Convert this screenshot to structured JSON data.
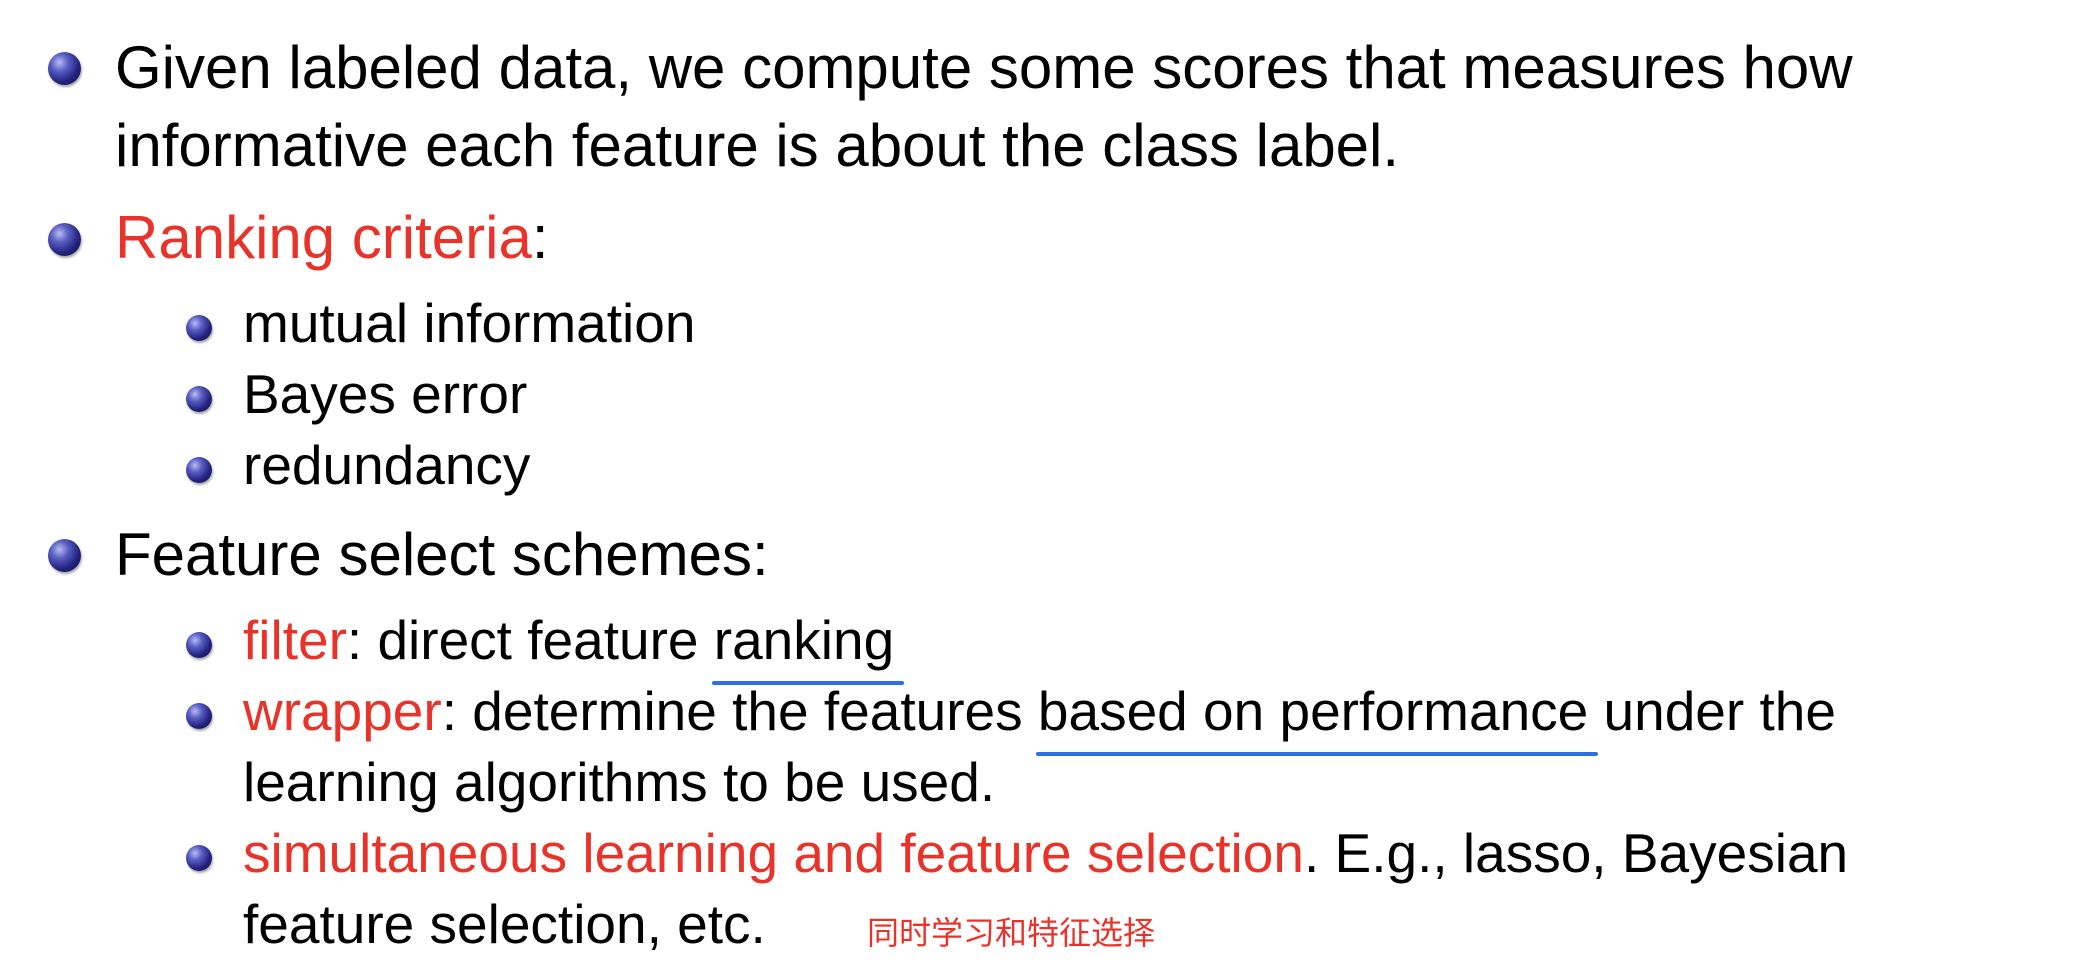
{
  "bullets": {
    "b1_line1": "Given labeled data, we compute some scores that measures how",
    "b1_line2": "informative each feature is about the class label.",
    "b2_red": "Ranking criteria",
    "b2_colon": ":",
    "criteria": [
      "mutual information",
      "Bayes error",
      "redundancy"
    ],
    "b3": "Feature select schemes:",
    "filter_label": "filter",
    "filter_text_a": ": direct feature ",
    "filter_text_u": "ranking",
    "wrapper_label": "wrapper",
    "wrapper_text_a": ": determine the features ",
    "wrapper_text_u": "based on performance",
    "wrapper_text_b": " under the",
    "wrapper_line2": "learning algorithms to be used.",
    "simul_label": "simultaneous learning and feature selection",
    "simul_text": ". E.g., lasso, Bayesian",
    "simul_line2": "feature selection, etc."
  },
  "annotation": {
    "handwritten_note": "同时学习和特征选择"
  },
  "colors": {
    "highlight_red": "#e8332a",
    "underline_blue": "#2d6fe6",
    "bullet_navy": "#23237f"
  }
}
